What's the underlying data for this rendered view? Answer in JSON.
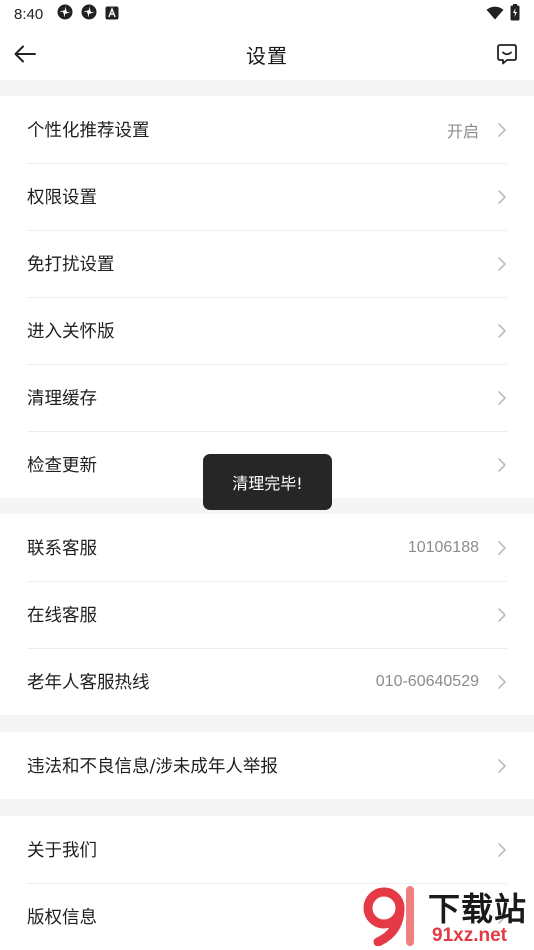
{
  "status_bar": {
    "time": "8:40",
    "left_icons": [
      "pinwheel-icon",
      "pinwheel-icon",
      "a-badge-icon"
    ],
    "right_icons": [
      "wifi-icon",
      "battery-icon"
    ]
  },
  "header": {
    "title": "设置",
    "back_icon": "arrow-left-icon",
    "feedback_icon": "message-icon"
  },
  "groups": [
    {
      "items": [
        {
          "label": "个性化推荐设置",
          "value": "开启"
        },
        {
          "label": "权限设置",
          "value": ""
        },
        {
          "label": "免打扰设置",
          "value": ""
        },
        {
          "label": "进入关怀版",
          "value": ""
        },
        {
          "label": "清理缓存",
          "value": ""
        },
        {
          "label": "检查更新",
          "value": ""
        }
      ]
    },
    {
      "items": [
        {
          "label": "联系客服",
          "value": "10106188"
        },
        {
          "label": "在线客服",
          "value": ""
        },
        {
          "label": "老年人客服热线",
          "value": "010-60640529"
        }
      ]
    },
    {
      "items": [
        {
          "label": "违法和不良信息/涉未成年人举报",
          "value": ""
        }
      ]
    },
    {
      "items": [
        {
          "label": "关于我们",
          "value": ""
        },
        {
          "label": "版权信息",
          "value": ""
        }
      ]
    }
  ],
  "toast": {
    "text": "清理完毕!"
  },
  "watermark": {
    "title": "下载站",
    "domain": "91xz.net"
  },
  "colors": {
    "background": "#f5f5f5",
    "card": "#ffffff",
    "text": "#1f1f1f",
    "muted": "#8c8c8c",
    "chevron": "#bdbdbd",
    "toast": "#262626",
    "watermark_red": "#e63946"
  }
}
